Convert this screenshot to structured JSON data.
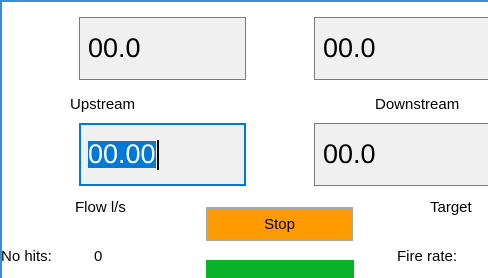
{
  "readouts": {
    "upstream": {
      "value": "00.0",
      "label": "Upstream"
    },
    "downstream": {
      "value": "00.0",
      "label": "Downstream"
    },
    "flow": {
      "value": "00.00",
      "label": "Flow l/s"
    },
    "target": {
      "value": "00.0",
      "label": "Target"
    }
  },
  "controls": {
    "stop_label": "Stop"
  },
  "stats": {
    "hits_label": "No hits:",
    "hits_value": "0",
    "fire_rate_label": "Fire rate:"
  },
  "colors": {
    "stop_button": "#ff9b00",
    "status_bar": "#0ab22a",
    "focus_accent": "#0078d7",
    "window_border": "#3c8dd8"
  }
}
